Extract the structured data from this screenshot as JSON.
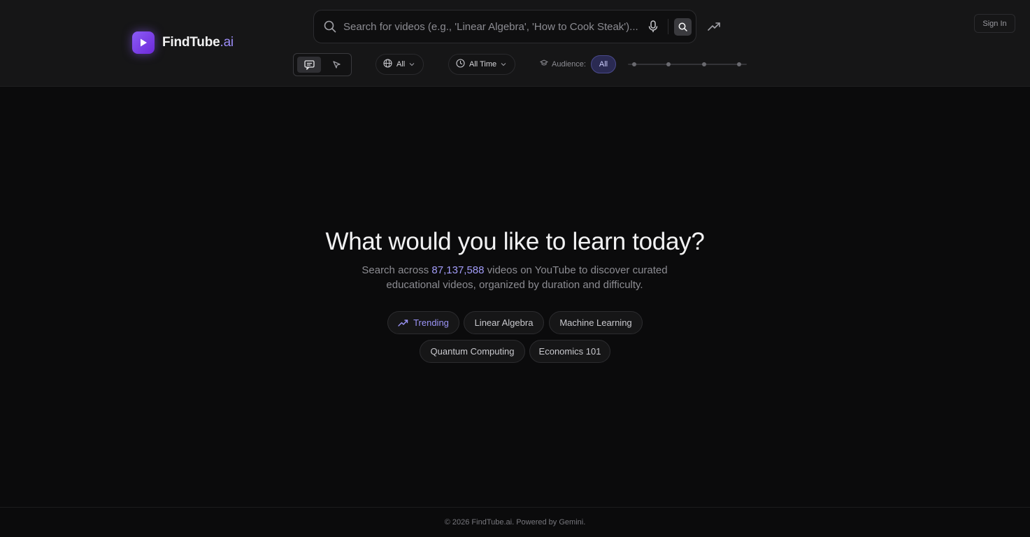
{
  "brand": {
    "name": "FindTube",
    "suffix": ".ai"
  },
  "search": {
    "placeholder": "Search for videos (e.g., 'Linear Algebra', 'How to Cook Steak')...",
    "value": ""
  },
  "header": {
    "sign_in_label": "Sign In"
  },
  "filters": {
    "language_value": "All",
    "time_value": "All Time",
    "audience_label": "Audience:",
    "audience_value": "All",
    "audience_levels_count": 5,
    "audience_level_selected": 1
  },
  "hero": {
    "title": "What would you like to learn today?",
    "subtitle_prefix": "Search across ",
    "video_count": "87,137,588",
    "subtitle_suffix": " videos on YouTube to discover curated educational videos, organized by duration and difficulty."
  },
  "suggestions": {
    "trending_label": "Trending",
    "items": [
      "Linear Algebra",
      "Machine Learning",
      "Quantum Computing",
      "Economics 101"
    ]
  },
  "footer": {
    "text": "© 2026 FindTube.ai. Powered by Gemini."
  },
  "colors": {
    "accent": "#8b5cf6",
    "accent_text": "#a29cf8",
    "background": "#0b0b0c",
    "header_bg": "#161617"
  },
  "icons": [
    "play-icon",
    "search-icon",
    "microphone-icon",
    "trending-icon",
    "chat-mode-icon",
    "pointer-mode-icon",
    "globe-icon",
    "clock-icon",
    "chevron-down-icon",
    "graduation-cap-icon"
  ]
}
